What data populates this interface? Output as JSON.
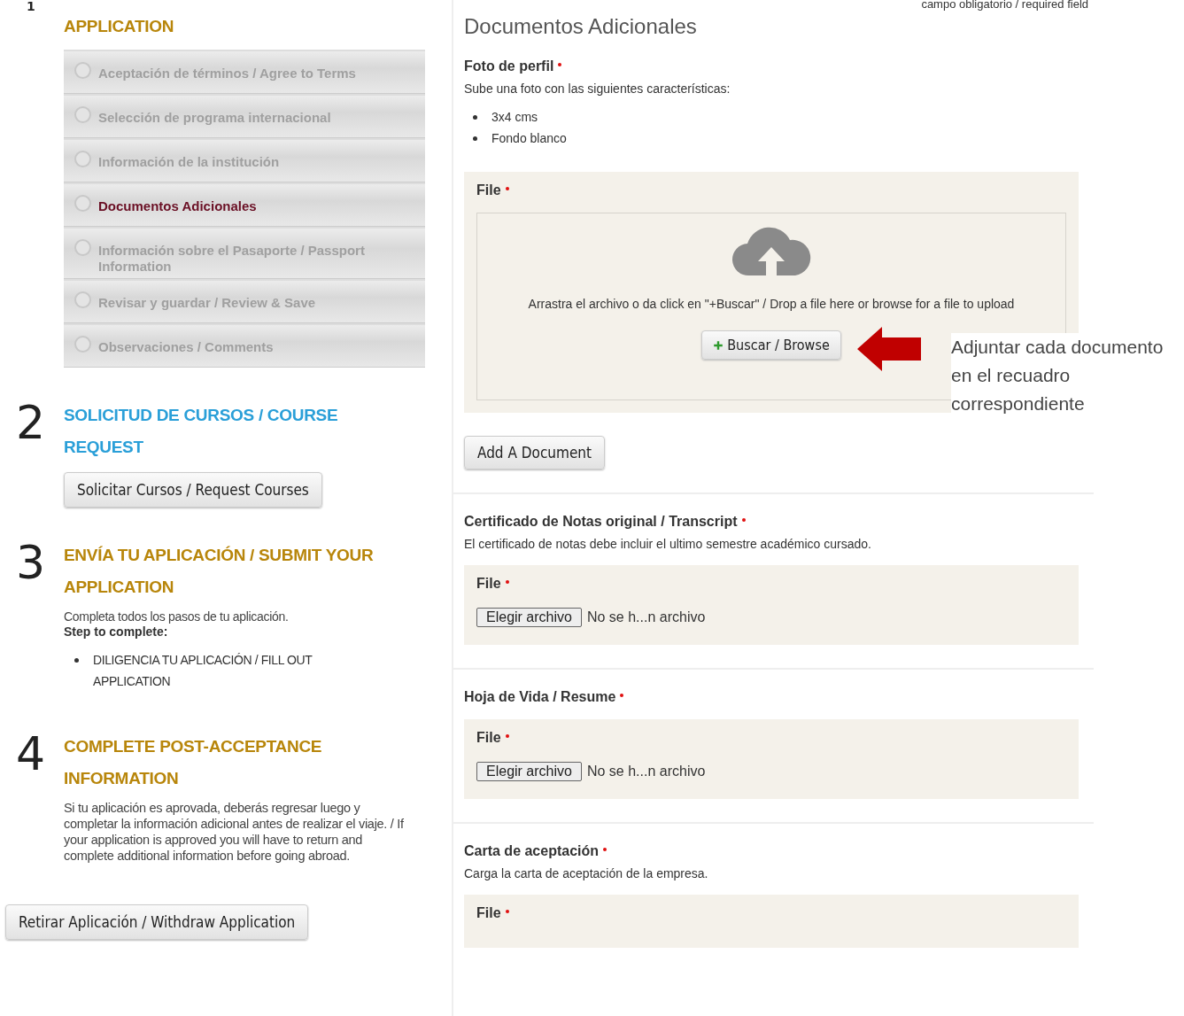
{
  "steps": [
    {
      "number": "1",
      "title": "APPLICATION",
      "color": "#b8860b",
      "nav": [
        {
          "label": "Aceptación de términos / Agree to Terms",
          "selected": false
        },
        {
          "label": "Selección de programa internacional",
          "selected": false
        },
        {
          "label": "Información de la institución",
          "selected": false
        },
        {
          "label": "Documentos Adicionales",
          "selected": true
        },
        {
          "label": "Información sobre el Pasaporte / Passport Information",
          "selected": false
        },
        {
          "label": "Revisar y guardar / Review & Save",
          "selected": false
        },
        {
          "label": "Observaciones / Comments",
          "selected": false
        }
      ]
    },
    {
      "number": "2",
      "title": "SOLICITUD DE CURSOS / COURSE REQUEST",
      "color": "#2a9fd8",
      "button": "Solicitar Cursos / Request Courses"
    },
    {
      "number": "3",
      "title": "ENVÍA TU APLICACIÓN / SUBMIT YOUR APPLICATION",
      "color": "#b8860b",
      "text": "Completa todos los pasos de tu aplicación.",
      "subtitle": "Step to complete:",
      "bullets": [
        "DILIGENCIA TU APLICACIÓN / FILL OUT APPLICATION"
      ]
    },
    {
      "number": "4",
      "title": "COMPLETE POST-ACCEPTANCE INFORMATION",
      "color": "#b8860b",
      "text": "Si tu aplicación es aprovada, deberás regresar luego y completar la información adicional antes de realizar el viaje. / If your application is approved you will have to return and complete additional information before going abroad."
    }
  ],
  "withdraw_button": "Retirar Aplicación / Withdraw Application",
  "required_note": "campo obligatorio / required field",
  "heading": "Documentos Adicionales",
  "sections": [
    {
      "title": "Foto de perfil",
      "required": true,
      "description": "Sube una foto con las siguientes características:",
      "bullets": [
        "3x4 cms",
        "Fondo blanco"
      ],
      "upload": {
        "kind": "dropzone",
        "label": "File",
        "required": true,
        "hint": "Arrastra el archivo o da click en \"+Buscar\" / Drop a file here or browse for a file to upload",
        "button": "Buscar / Browse",
        "callout": "Adjuntar cada documento en el recuadro correspondiente"
      },
      "add_button": "Add A Document"
    },
    {
      "title": "Certificado de Notas original / Transcript",
      "required": true,
      "description": "El certificado de notas debe incluir el ultimo semestre académico cursado.",
      "upload": {
        "kind": "file_input",
        "label": "File",
        "required": true,
        "button": "Elegir archivo",
        "status": "No se h...n archivo"
      }
    },
    {
      "title": "Hoja de Vida / Resume",
      "required": true,
      "upload": {
        "kind": "file_input",
        "label": "File",
        "required": true,
        "button": "Elegir archivo",
        "status": "No se h...n archivo"
      }
    },
    {
      "title": "Carta de aceptación",
      "required": true,
      "description": "Carga la carta de aceptación de la empresa.",
      "upload": {
        "kind": "file_cut",
        "label": "File",
        "required": true
      }
    }
  ]
}
